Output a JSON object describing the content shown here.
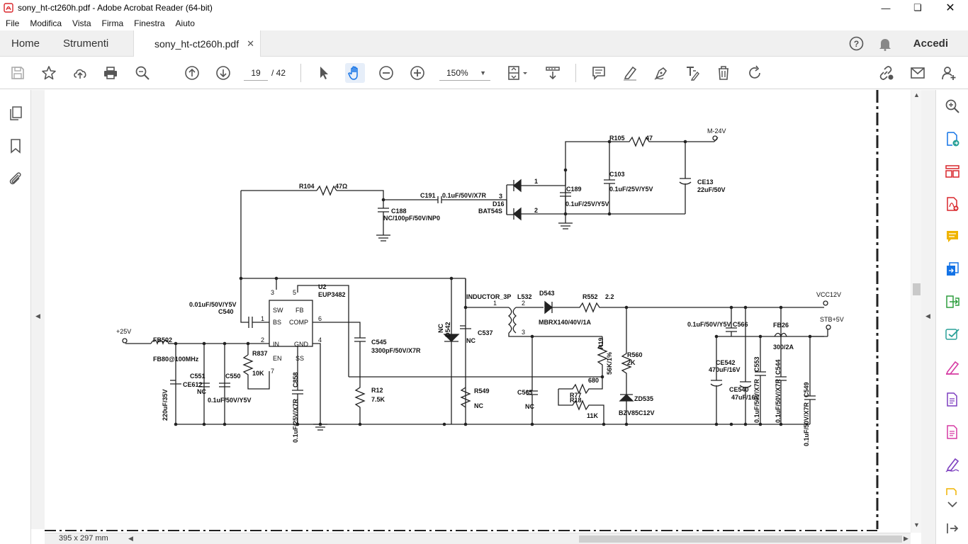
{
  "window": {
    "title": "sony_ht-ct260h.pdf - Adobe Acrobat Reader (64-bit)"
  },
  "menu": [
    "File",
    "Modifica",
    "Vista",
    "Firma",
    "Finestra",
    "Aiuto"
  ],
  "tabs": {
    "home": "Home",
    "tools": "Strumenti",
    "doc": "sony_ht-ct260h.pdf",
    "signin": "Accedi"
  },
  "toolbar": {
    "page_current": "19",
    "page_total": "/ 42",
    "zoom": "150%"
  },
  "status": {
    "page_size": "395 x 297 mm"
  },
  "icons": {
    "left": [
      "thumbnails-icon",
      "bookmark-icon",
      "attachment-icon"
    ],
    "right": [
      "search-zoom-icon",
      "export-pdf-icon",
      "organize-pages-icon",
      "create-pdf-icon",
      "comment-icon",
      "combine-files-icon",
      "send-review-icon",
      "fill-sign-icon",
      "edit-pdf-icon",
      "protect-icon",
      "more-tools-icon",
      "sign-icon"
    ]
  },
  "schematic": {
    "labels": {
      "r104": "R104",
      "r104v": "47Ω",
      "c191": "C191",
      "c191v": "0.1uF/50V/X7R",
      "c188": "C188",
      "c188v": "NC/100pF/50V/NP0",
      "d16": "D16",
      "d16v": "BAT54S",
      "p3": "3",
      "p1": "1",
      "p2": "2",
      "c189": "C189",
      "c189v": "0.1uF/25V/Y5V",
      "r105": "R105",
      "r105v": "47",
      "c103": "C103",
      "c103v": "0.1uF/25V/Y5V",
      "ce13": "CE13",
      "ce13v": "22uF/50V",
      "m24": "M-24V",
      "u2": "U2",
      "eup": "EUP3482",
      "c540v": "0.01uF/50V/Y5V",
      "c540": "C540",
      "pin3": "3",
      "pin5": "5",
      "pin1": "1",
      "pin6": "6",
      "pin2": "2",
      "pin4": "4",
      "pin7": "7",
      "pin8": "8",
      "sw": "SW",
      "fb": "FB",
      "bs": "BS",
      "comp": "COMP",
      "in": "IN",
      "gnd": "GND",
      "en": "EN",
      "ss": "SS",
      "v25": "+25V",
      "fb502": "FB502",
      "fb80": "FB80@100MHz",
      "r837": "R837",
      "r837v": "10K",
      "c551": "C551",
      "ce612": "CE612",
      "nc1": "NC",
      "c550": "C550",
      "c550v": "0.1uF/50V/Y5V",
      "ce612v": "220uF/35V",
      "c858": "C858",
      "c858v": "0.1uF/25V/X7R",
      "c545": "C545",
      "c545v": "3300pF/50V/X7R",
      "r12": "R12",
      "r12v": "7.5K",
      "nc542": "NC",
      "d542": "D542",
      "c537": "C537",
      "nc537": "NC",
      "r549": "R549",
      "nc549": "NC",
      "ind": "INDUCTOR_3P",
      "l532": "L532",
      "l1": "1",
      "l2": "2",
      "l3": "3",
      "d543": "D543",
      "mbrx": "MBRX140/40V/1A",
      "r552": "R552",
      "r552v": "2.2",
      "c565": "C565",
      "nc565": "NC",
      "r19": "R19",
      "r19v": "56K/1%",
      "r77": "R77",
      "r77v": "680",
      "r18": "R18",
      "r18v": "11K",
      "r560": "R560",
      "r560v": "2K",
      "zd535": "ZD535",
      "bzv": "BZV85C12V",
      "vcc12": "VCC12V",
      "stb5": "STB+5V",
      "c566v": "0.1uF/50V/Y5V",
      "c566": "C566",
      "fb26": "FB26",
      "fb26v": "300/2A",
      "ce542": "CE542",
      "ce542v": "470uF/16V",
      "ce540": "CE540",
      "ce540v": "47uF/16V",
      "c553": "C553",
      "c553v": "0.1uF/50V/X7R",
      "c544": "C544",
      "c544v": "0.1uF/50V/X7R",
      "c549": "C549",
      "c549v": "0.1uF/50V/X7R"
    }
  }
}
